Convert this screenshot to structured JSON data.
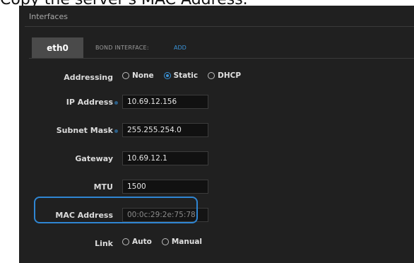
{
  "caption": "Copy the server's MAC Address.",
  "section": {
    "title": "Interfaces"
  },
  "tabs": {
    "active_tab": "eth0",
    "bond_label": "BOND INTERFACE:",
    "bond_add": "ADD"
  },
  "addressing": {
    "label": "Addressing",
    "options": [
      "None",
      "Static",
      "DHCP"
    ],
    "selected": "Static"
  },
  "ip": {
    "label": "IP Address",
    "value": "10.69.12.156"
  },
  "subnet": {
    "label": "Subnet Mask",
    "value": "255.255.254.0"
  },
  "gateway": {
    "label": "Gateway",
    "value": "10.69.12.1"
  },
  "mtu": {
    "label": "MTU",
    "value": "1500"
  },
  "mac": {
    "label": "MAC Address",
    "value": "00:0c:29:2e:75:78"
  },
  "link": {
    "label": "Link",
    "options": [
      "Auto",
      "Manual"
    ],
    "selected": ""
  },
  "colors": {
    "accent": "#3a93d8",
    "highlight": "#2f86d3",
    "panel": "#202020"
  }
}
